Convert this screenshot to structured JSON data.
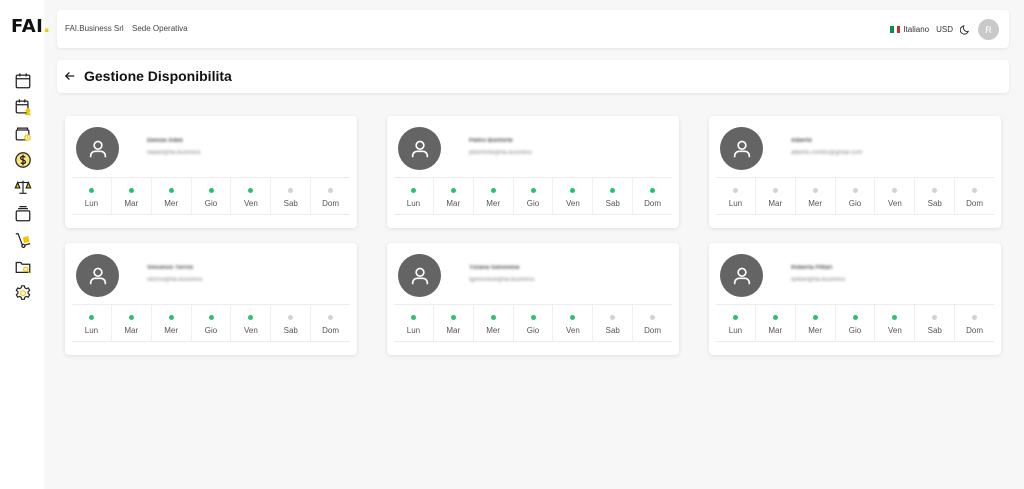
{
  "logo": {
    "text": "FAI",
    "dot": "."
  },
  "sidebar": {
    "icons": [
      "calendar-icon",
      "calendar-user-icon",
      "wallet-icon",
      "dollar-circle-icon",
      "scale-icon",
      "layers-icon",
      "hand-truck-icon",
      "folder-search-icon",
      "gear-icon"
    ]
  },
  "header": {
    "company": "FAI.Business Srl",
    "location": "Sede Operativa",
    "language": "Italiano",
    "currency": "USD",
    "avatar_initial": "R"
  },
  "page": {
    "title": "Gestione Disponibilita"
  },
  "colors": {
    "available": "#2bbf73",
    "unavailable": "#d2d2d2",
    "brand": "#f2c500",
    "avatar": "#646464"
  },
  "day_labels": [
    "Lun",
    "Mar",
    "Mer",
    "Gio",
    "Ven",
    "Sab",
    "Dom"
  ],
  "employees": [
    {
      "name": "Denise Adeli",
      "email": "dadeli@fai.business",
      "availability": [
        true,
        true,
        true,
        true,
        true,
        false,
        false
      ]
    },
    {
      "name": "Pietro Bonforte",
      "email": "pbonforte@fai.business",
      "availability": [
        true,
        true,
        true,
        true,
        true,
        true,
        true
      ]
    },
    {
      "name": "Alberto",
      "email": "alberto.corti65@gmail.com",
      "availability": [
        false,
        false,
        false,
        false,
        false,
        false,
        false
      ]
    },
    {
      "name": "Vincenzo Torrisi",
      "email": "vtorrisi@fai.business",
      "availability": [
        true,
        true,
        true,
        true,
        true,
        false,
        false
      ]
    },
    {
      "name": "Tiziana Genovese",
      "email": "tgenovese@fai.business",
      "availability": [
        true,
        true,
        true,
        true,
        true,
        false,
        false
      ]
    },
    {
      "name": "Roberta Pittari",
      "email": "rpittari@fai.business",
      "availability": [
        true,
        true,
        true,
        true,
        true,
        false,
        false
      ]
    }
  ]
}
